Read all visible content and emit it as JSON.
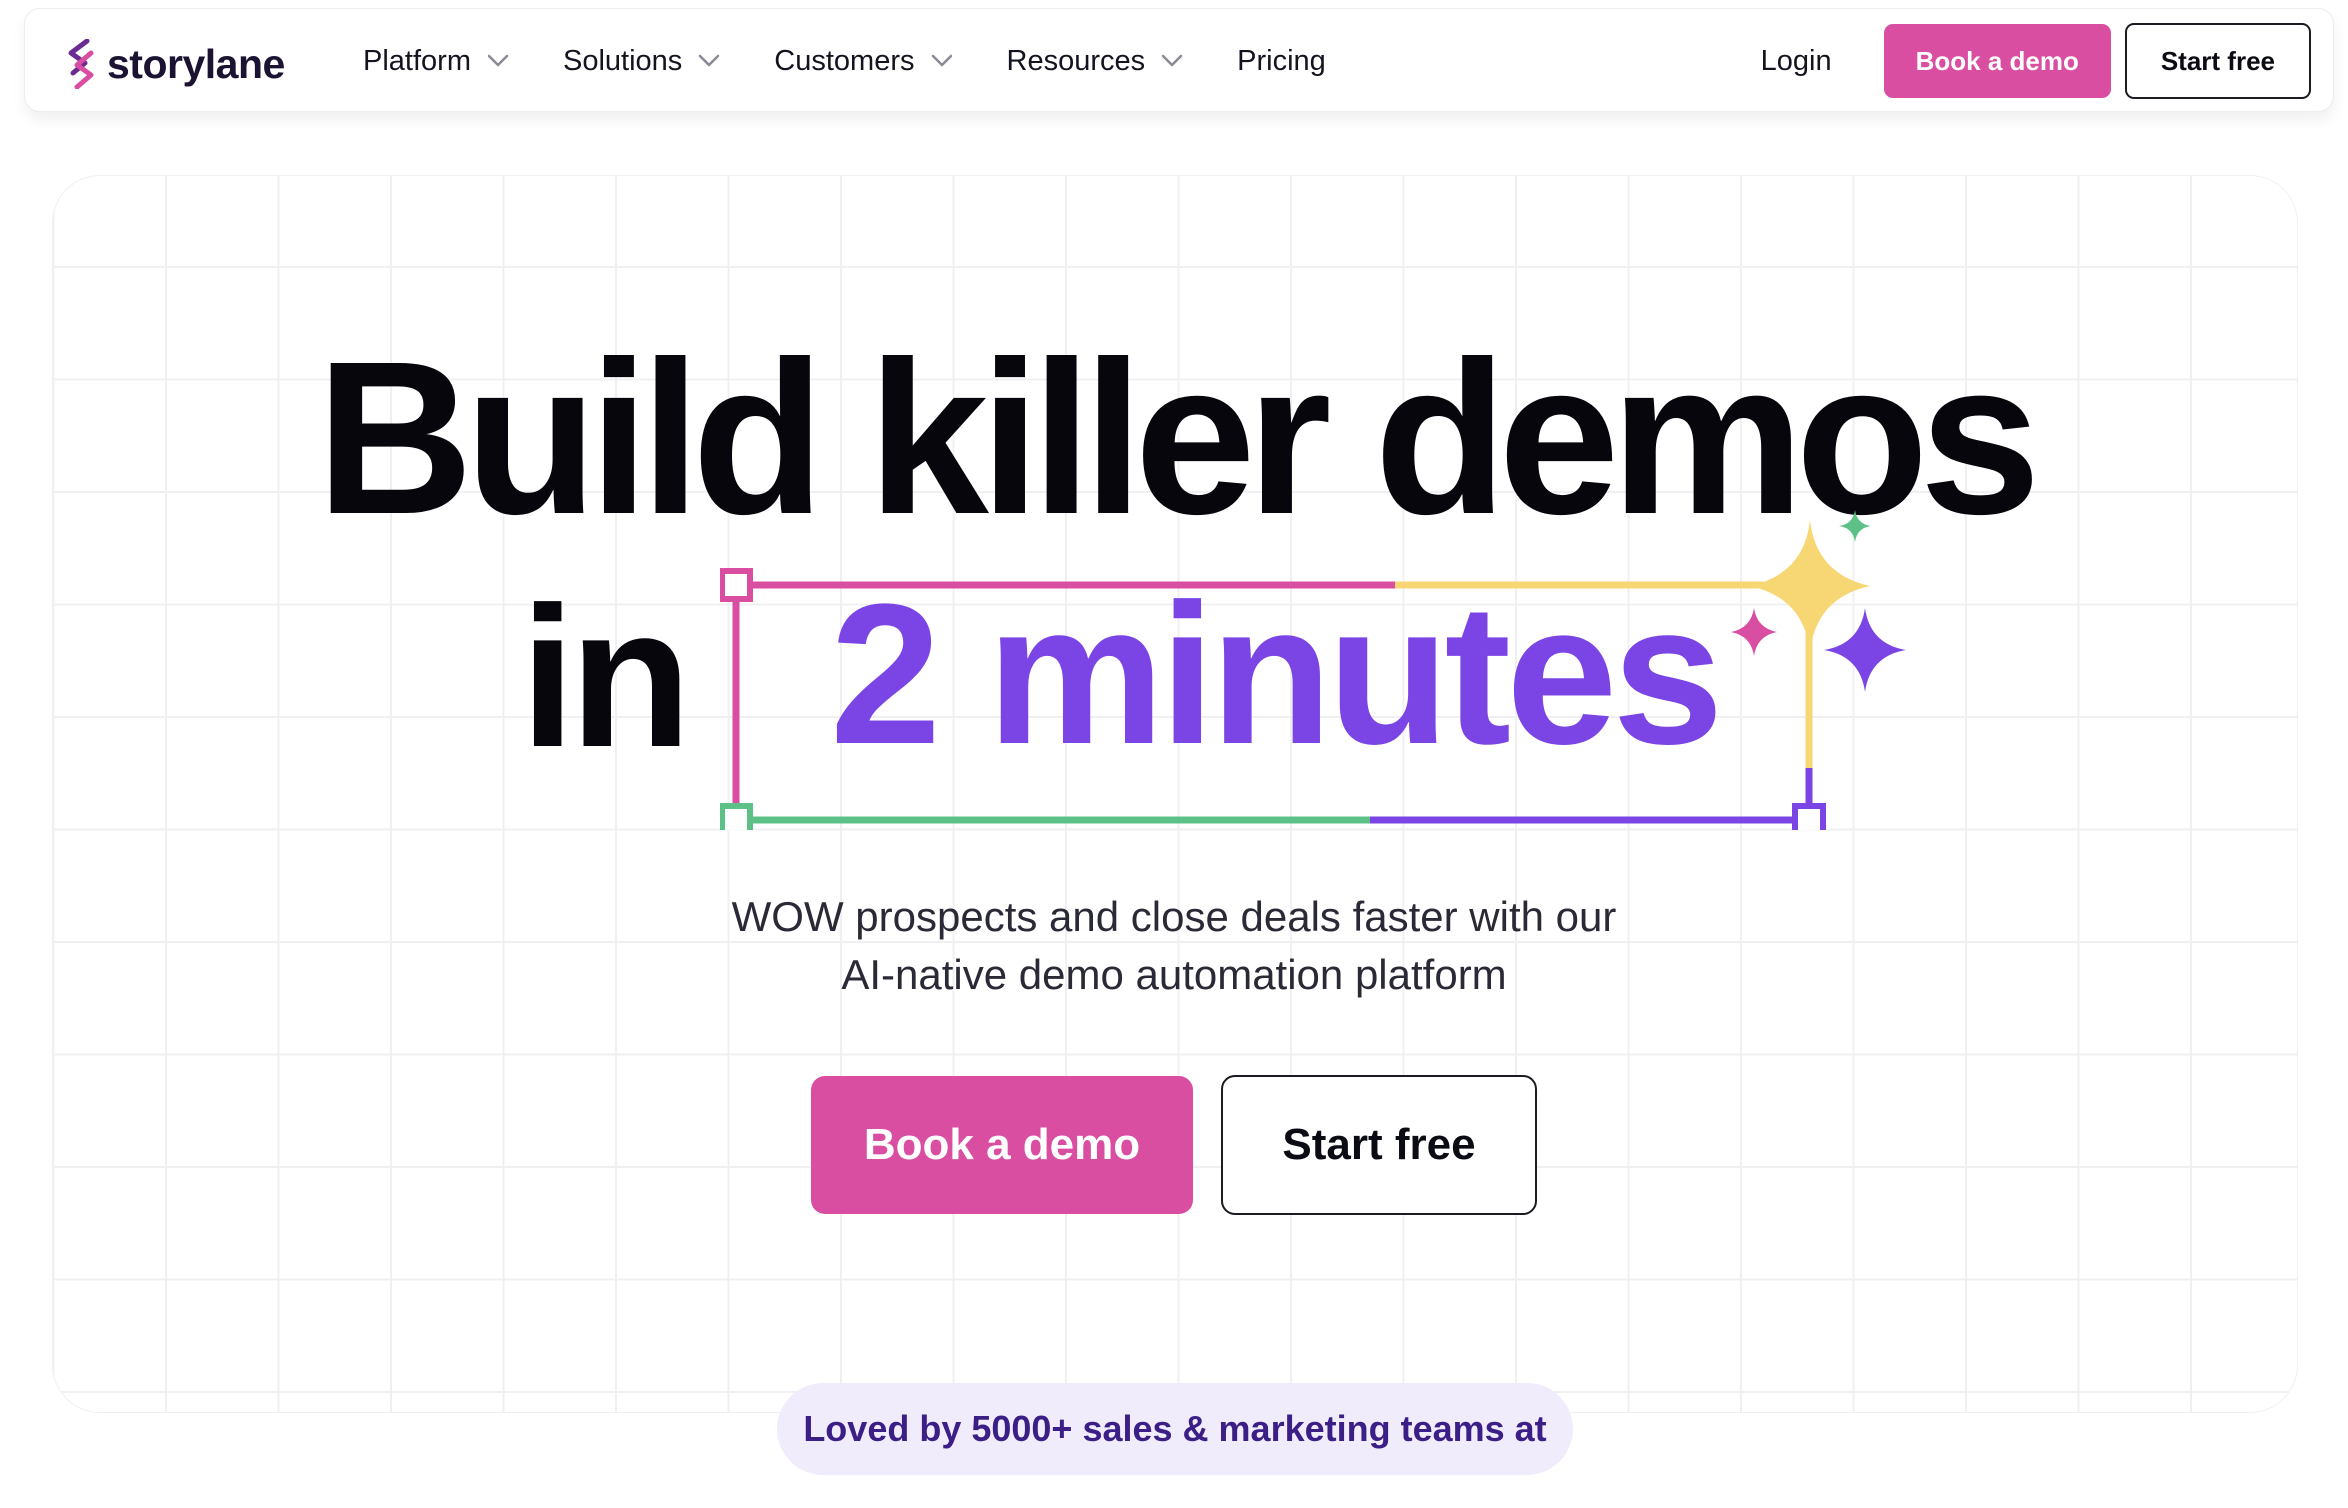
{
  "brand": {
    "name": "storylane",
    "logo_icon": "storylane-s-logo-icon",
    "logo_colors": [
      "#6a2c91",
      "#d94ea1"
    ]
  },
  "nav": {
    "items": [
      {
        "label": "Platform",
        "has_dropdown": true
      },
      {
        "label": "Solutions",
        "has_dropdown": true
      },
      {
        "label": "Customers",
        "has_dropdown": true
      },
      {
        "label": "Resources",
        "has_dropdown": true
      },
      {
        "label": "Pricing",
        "has_dropdown": false
      }
    ],
    "login_label": "Login",
    "book_demo_label": "Book a demo",
    "start_free_label": "Start free"
  },
  "hero": {
    "headline_line1": "Build killer demos",
    "headline_in": "in",
    "headline_highlight": "2 minutes",
    "subtitle_line1": "WOW prospects and close deals faster with our",
    "subtitle_line2": "AI-native demo automation platform",
    "cta_primary": "Book a demo",
    "cta_secondary": "Start free",
    "social_proof": "Loved by 5000+ sales & marketing teams at"
  },
  "colors": {
    "accent_pink": "#d94ea1",
    "accent_purple": "#7b45e6",
    "accent_green": "#5dc187",
    "accent_yellow": "#f7d774",
    "pill_bg": "#f1ecfb",
    "pill_text": "#3b1e86"
  }
}
